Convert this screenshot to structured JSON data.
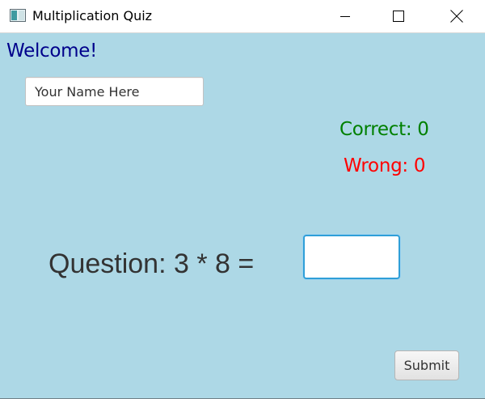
{
  "window": {
    "title": "Multiplication Quiz",
    "icon": "app-window-icon",
    "controls": {
      "minimize_icon": "minimize-icon",
      "maximize_icon": "maximize-icon",
      "close_icon": "close-icon"
    }
  },
  "greeting": {
    "text": "Welcome!",
    "color": "#00008b"
  },
  "name_field": {
    "value": "Your Name Here",
    "placeholder": ""
  },
  "score": {
    "correct_label": "Correct: 0",
    "wrong_label": "Wrong: 0",
    "correct_color": "#008000",
    "wrong_color": "#ff0000"
  },
  "quiz": {
    "question_text": "Question: 3 * 8 =",
    "answer_value": "",
    "answer_placeholder": ""
  },
  "actions": {
    "submit_label": "Submit"
  },
  "colors": {
    "background": "#add8e6",
    "focus_border": "#2f9fd8"
  }
}
